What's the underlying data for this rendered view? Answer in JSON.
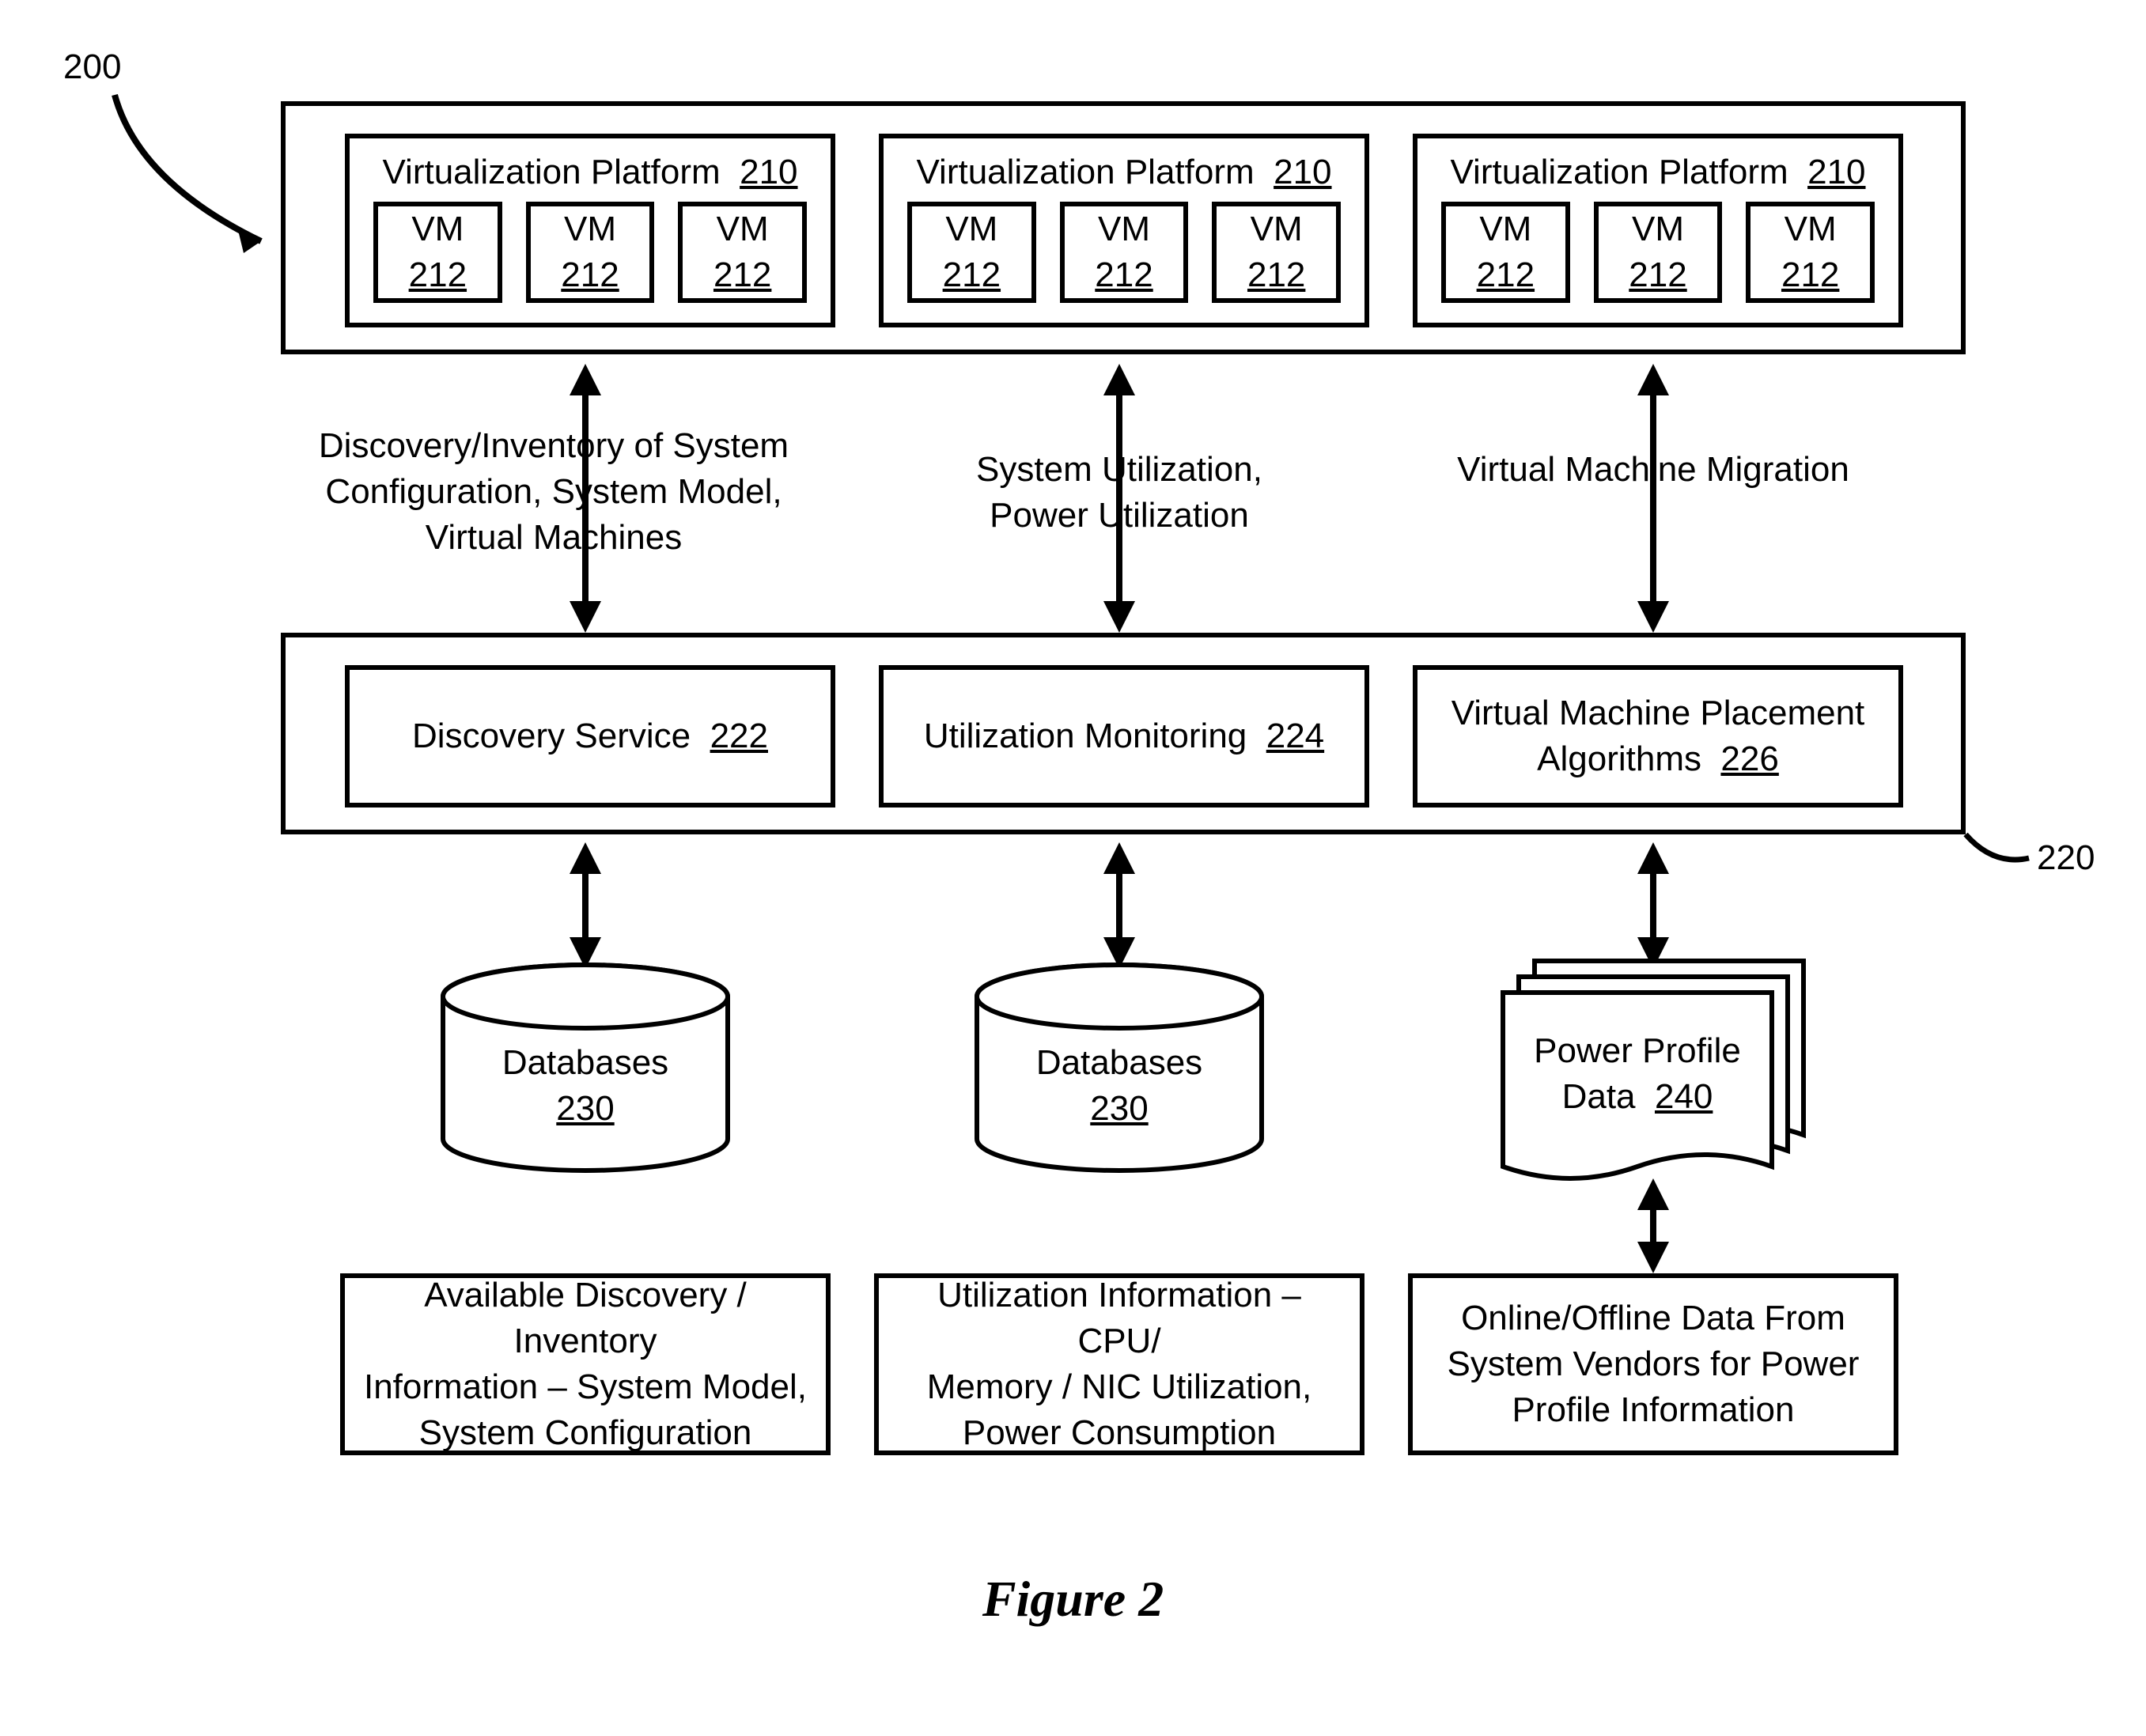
{
  "figure_ref_num": "200",
  "figure_caption": "Figure 2",
  "platforms_container_ref": "",
  "platform": {
    "title_prefix": "Virtualization Platform",
    "ref": "210",
    "vm_prefix": "VM",
    "vm_ref": "212"
  },
  "arrows_labels": {
    "left": "Discovery/Inventory of System Configuration, System Model, Virtual Machines",
    "mid": "System Utilization, Power Utilization",
    "right": "Virtual Machine Migration"
  },
  "services_container_ref": "220",
  "services": {
    "left": {
      "name": "Discovery Service",
      "ref": "222"
    },
    "mid": {
      "name": "Utilization Monitoring",
      "ref": "224"
    },
    "right": {
      "name_line1": "Virtual Machine Placement",
      "name_line2": "Algorithms",
      "ref": "226"
    }
  },
  "dbs": {
    "label": "Databases",
    "ref": "230"
  },
  "power_profile": {
    "line1": "Power Profile",
    "line2_prefix": "Data",
    "ref": "240"
  },
  "bottom_boxes": {
    "left": "Available Discovery / Inventory Information – System Model, System Configuration",
    "mid": "Utilization Information – CPU/ Memory / NIC Utilization, Power Consumption",
    "right": "Online/Offline Data From System Vendors for Power Profile Information"
  }
}
